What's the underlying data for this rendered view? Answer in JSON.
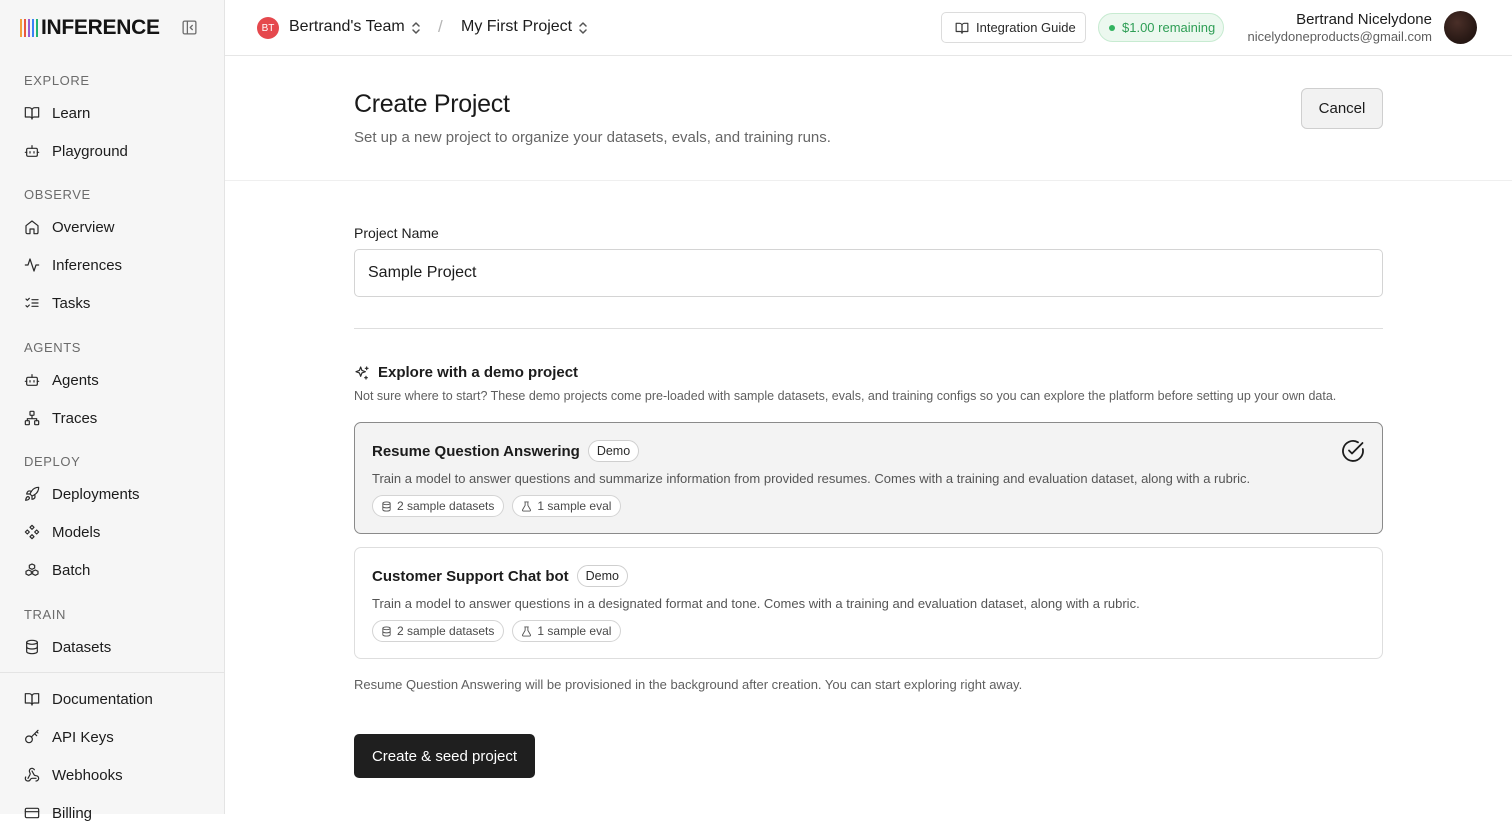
{
  "brand": {
    "name": "INFERENCE",
    "bar_colors": [
      "#f2a03d",
      "#e8573f",
      "#9b59d0",
      "#3b82f6",
      "#22b573"
    ]
  },
  "sidebar": {
    "sections": [
      {
        "label": "EXPLORE",
        "items": [
          {
            "label": "Learn",
            "icon": "book-icon"
          },
          {
            "label": "Playground",
            "icon": "bot-icon"
          }
        ]
      },
      {
        "label": "OBSERVE",
        "items": [
          {
            "label": "Overview",
            "icon": "home-icon"
          },
          {
            "label": "Inferences",
            "icon": "activity-icon"
          },
          {
            "label": "Tasks",
            "icon": "list-checks-icon"
          }
        ]
      },
      {
        "label": "AGENTS",
        "items": [
          {
            "label": "Agents",
            "icon": "bot-icon"
          },
          {
            "label": "Traces",
            "icon": "network-icon"
          }
        ]
      },
      {
        "label": "DEPLOY",
        "items": [
          {
            "label": "Deployments",
            "icon": "rocket-icon"
          },
          {
            "label": "Models",
            "icon": "diamond-grid-icon"
          },
          {
            "label": "Batch",
            "icon": "boxes-icon"
          }
        ]
      },
      {
        "label": "TRAIN",
        "items": [
          {
            "label": "Datasets",
            "icon": "database-icon"
          }
        ]
      }
    ],
    "footer_items": [
      {
        "label": "Documentation",
        "icon": "book-icon"
      },
      {
        "label": "API Keys",
        "icon": "key-icon"
      },
      {
        "label": "Webhooks",
        "icon": "webhook-icon"
      },
      {
        "label": "Billing",
        "icon": "credit-card-icon"
      }
    ]
  },
  "header": {
    "team_initials": "BT",
    "team_name": "Bertrand's Team",
    "separator": "/",
    "project_name": "My First Project",
    "integration_guide_label": "Integration Guide",
    "credits_label": "$1.00 remaining",
    "user_name": "Bertrand Nicelydone",
    "user_email": "nicelydoneproducts@gmail.com"
  },
  "page": {
    "title": "Create Project",
    "subtitle": "Set up a new project to organize your datasets, evals, and training runs.",
    "cancel_label": "Cancel"
  },
  "form": {
    "project_name_label": "Project Name",
    "project_name_value": "Sample Project"
  },
  "demo": {
    "heading": "Explore with a demo project",
    "description": "Not sure where to start? These demo projects come pre-loaded with sample datasets, evals, and training configs so you can explore the platform before setting up your own data.",
    "projects": [
      {
        "title": "Resume Question Answering",
        "badge": "Demo",
        "description": "Train a model to answer questions and summarize information from provided resumes. Comes with a training and evaluation dataset, along with a rubric.",
        "datasets_chip": "2 sample datasets",
        "eval_chip": "1 sample eval",
        "selected": true
      },
      {
        "title": "Customer Support Chat bot",
        "badge": "Demo",
        "description": "Train a model to answer questions in a designated format and tone. Comes with a training and evaluation dataset, along with a rubric.",
        "datasets_chip": "2 sample datasets",
        "eval_chip": "1 sample eval",
        "selected": false
      }
    ],
    "provision_note": "Resume Question Answering will be provisioned in the background after creation. You can start exploring right away."
  },
  "actions": {
    "create_label": "Create & seed project"
  }
}
